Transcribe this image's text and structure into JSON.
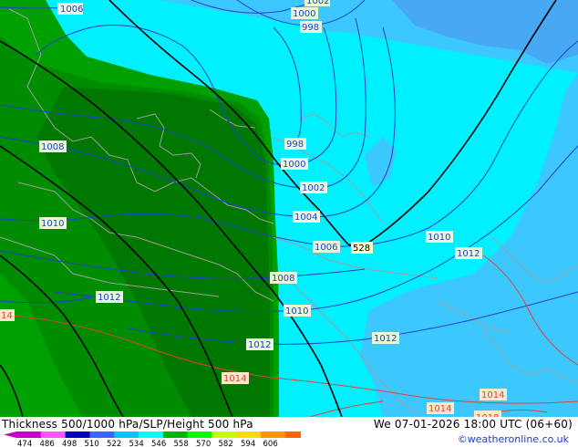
{
  "title": "Thickness 500/1000 hPa/SLP/Height 500 hPa",
  "run_info": "We 07-01-2026 18:00 UTC (06+60)",
  "credit": "©weatheronline.co.uk",
  "legend": {
    "ticks": [
      "474",
      "486",
      "498",
      "510",
      "522",
      "534",
      "546",
      "558",
      "570",
      "582",
      "594",
      "606"
    ],
    "colors": [
      "#c800c8",
      "#ff55ff",
      "#0000b4",
      "#3c64ff",
      "#00c8ff",
      "#00ffff",
      "#00b400",
      "#00ff00",
      "#c8ff00",
      "#ffdc00",
      "#ff9600",
      "#ff6400"
    ]
  },
  "map": {
    "colors": {
      "deep_blue": "#48a8f4",
      "blue": "#3cc8ff",
      "cyan": "#00f0ff",
      "green_light": "#00a000",
      "green_mid": "#008c00",
      "green_dark": "#007800",
      "isobar_blue": "#2040d0",
      "isobar_red": "#e04040",
      "coast": "#a0a0a0",
      "height_line": "#000000"
    },
    "isobar_labels": [
      {
        "text": "1006"
      },
      {
        "text": "1002"
      },
      {
        "text": "1000"
      },
      {
        "text": "998"
      },
      {
        "text": "1008"
      },
      {
        "text": "998"
      },
      {
        "text": "1000"
      },
      {
        "text": "1002"
      },
      {
        "text": "1004"
      },
      {
        "text": "1010"
      },
      {
        "text": "1006"
      },
      {
        "text": "528"
      },
      {
        "text": "1010"
      },
      {
        "text": "1012"
      },
      {
        "text": "1008"
      },
      {
        "text": "1012"
      },
      {
        "text": "1010"
      },
      {
        "text": "1012"
      },
      {
        "text": "1012"
      },
      {
        "text": "14"
      },
      {
        "text": "1014"
      },
      {
        "text": "1014"
      },
      {
        "text": "1014"
      },
      {
        "text": "1018"
      }
    ]
  }
}
